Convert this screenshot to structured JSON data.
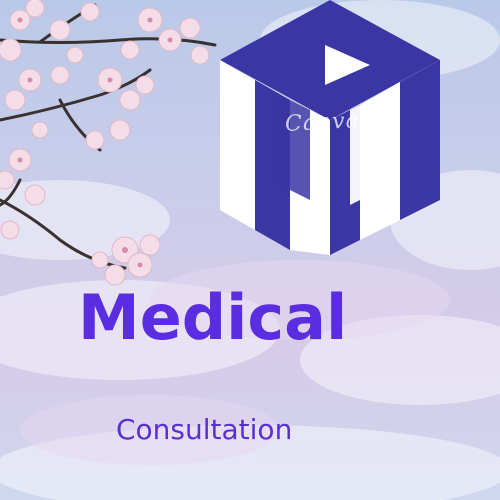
{
  "headline": "Medical",
  "subheadline": "Consultation",
  "watermark": "Canva",
  "colors": {
    "logo_blue": "#3a36a3",
    "logo_white": "#ffffff",
    "text_purple": "#5a2ee0",
    "sky": "#c9cdea",
    "blossom": "#f3dce4"
  },
  "icons": {
    "logo": "isometric-m-cube-logo",
    "branch": "cherry-blossom-branch"
  }
}
